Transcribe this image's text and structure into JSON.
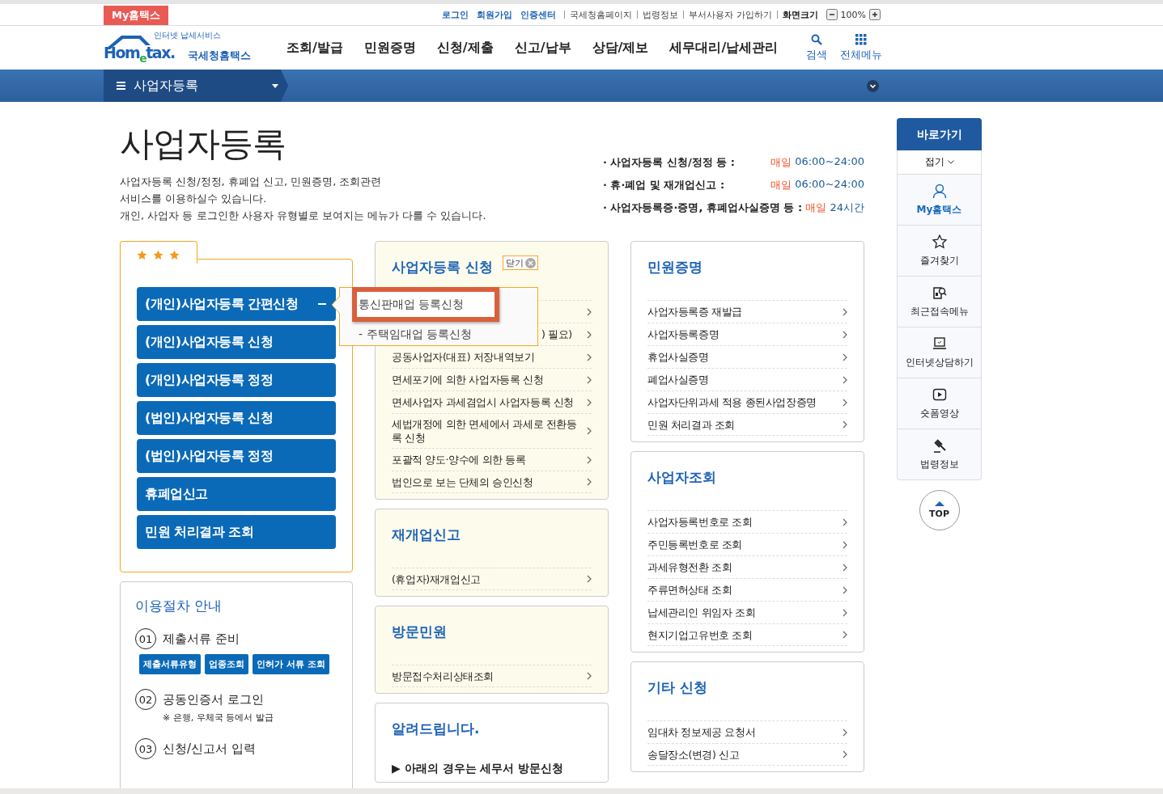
{
  "top_bar": {
    "brand_tab": "My홈택스",
    "links": [
      {
        "label": "로그인",
        "kind": "primary"
      },
      {
        "label": "회원가입",
        "kind": "primary"
      },
      {
        "label": "인증센터",
        "kind": "primary"
      },
      {
        "label": "국세청홈페이지",
        "kind": "plain"
      },
      {
        "label": "법령정보",
        "kind": "plain"
      },
      {
        "label": "부서사용자 가입하기",
        "kind": "plain"
      },
      {
        "label": "화면크기",
        "kind": "strong"
      }
    ],
    "zoom": "100%"
  },
  "header": {
    "logo": {
      "tagline": "인터넷 납세서비스",
      "wordmark": "Hom$_{e}$tax.",
      "name": "국세청홈택스"
    },
    "nav": [
      "조회/발급",
      "민원증명",
      "신청/제출",
      "신고/납부",
      "상담/제보",
      "세무대리/납세관리"
    ],
    "tools": [
      {
        "label": "검색",
        "kind": "search"
      },
      {
        "label": "전체메뉴",
        "kind": "grid"
      }
    ]
  },
  "menu_bar": {
    "current": "사업자등록"
  },
  "page": {
    "title": "사업자등록",
    "description": "사업자등록 신청/정정, 휴폐업 신고, 민원증명, 조회관련\n서비스를 이용하실수 있습니다.\n개인, 사업자 등 로그인한 사용자 유형별로 보여지는 메뉴가 다를 수 있습니다.",
    "hours": [
      {
        "label": "· 사업자등록 신청/정정 등 :",
        "day": "매일",
        "time": "06:00~24:00"
      },
      {
        "label": "· 휴·폐업 및 재개업신고 :",
        "day": "매일",
        "time": "06:00~24:00"
      },
      {
        "label": "· 사업자등록증·증명, 휴폐업사실증명 등 :",
        "day": "매일",
        "time": "24시간"
      }
    ]
  },
  "quick_buttons": [
    {
      "label": "(개인)사업자등록 간편신청",
      "expanded": true
    },
    {
      "label": "(개인)사업자등록 신청",
      "expanded": false
    },
    {
      "label": "(개인)사업자등록 정정",
      "expanded": false
    },
    {
      "label": "(법인)사업자등록 신청",
      "expanded": false
    },
    {
      "label": "(법인)사업자등록 정정",
      "expanded": false
    },
    {
      "label": "휴폐업신고",
      "expanded": false
    },
    {
      "label": "민원 처리결과 조회",
      "expanded": false
    }
  ],
  "popup": {
    "items": [
      {
        "label": "통신판매업 등록신청",
        "selected": true
      },
      {
        "label": "- 주택임대업 등록신청",
        "selected": false
      }
    ]
  },
  "guide": {
    "title": "이용절차 안내",
    "steps": [
      {
        "number": "01",
        "label": "제출서류 준비",
        "buttons": [
          "제출서류유형",
          "업종조회",
          "인허가 서류 조회"
        ]
      },
      {
        "number": "02",
        "label": "공동인증서 로그인",
        "note": "※ 은행, 우체국 등에서 발급"
      },
      {
        "number": "03",
        "label": "신청/신고서 입력"
      }
    ]
  },
  "center_cards": [
    {
      "title": "사업자등록 신청",
      "shaded": true,
      "close_label": "닫기",
      "items": [
        {
          "kind": "covered"
        },
        {
          "kind": "covered",
          "label": ") 필요)"
        },
        {
          "kind": "link",
          "label": "공동사업자(대표) 저장내역보기"
        },
        {
          "kind": "link",
          "label": "면세포기에 의한 사업자등록 신청"
        },
        {
          "kind": "link",
          "label": "면세사업자 과세겸업시 사업자등록 신청"
        },
        {
          "kind": "link",
          "label": "세법개정에 의한 면세에서 과세로 전환등록 신청"
        },
        {
          "kind": "link",
          "label": "포괄적 양도·양수에 의한 등록"
        },
        {
          "kind": "link",
          "label": "법인으로 보는 단체의 승인신청"
        }
      ]
    },
    {
      "title": "재개업신고",
      "shaded": true,
      "items": [
        {
          "kind": "link",
          "label": "(휴업자)재개업신고"
        }
      ]
    },
    {
      "title": "방문민원",
      "shaded": true,
      "items": [
        {
          "kind": "link",
          "label": "방문접수처리상태조회"
        }
      ]
    },
    {
      "title": "알려드립니다.",
      "shaded": false,
      "items": [
        {
          "kind": "notice",
          "label": "▶ 아래의 경우는 세무서 방문신청"
        }
      ]
    }
  ],
  "right_cards": [
    {
      "title": "민원증명",
      "shaded": false,
      "items": [
        {
          "kind": "link",
          "label": "사업자등록증 재발급"
        },
        {
          "kind": "link",
          "label": "사업자등록증명"
        },
        {
          "kind": "link",
          "label": "휴업사실증명"
        },
        {
          "kind": "link",
          "label": "폐업사실증명"
        },
        {
          "kind": "link",
          "label": "사업자단위과세 적용 종된사업장증명"
        },
        {
          "kind": "link",
          "label": "민원 처리결과 조회"
        }
      ]
    },
    {
      "title": "사업자조회",
      "shaded": false,
      "items": [
        {
          "kind": "link",
          "label": "사업자등록번호로 조회"
        },
        {
          "kind": "link",
          "label": "주민등록번호로 조회"
        },
        {
          "kind": "link",
          "label": "과세유형전환 조회"
        },
        {
          "kind": "link",
          "label": "주류면허상태 조회"
        },
        {
          "kind": "link",
          "label": "납세관리인 위임자 조회"
        },
        {
          "kind": "link",
          "label": "현지기업고유번호 조회"
        }
      ]
    },
    {
      "title": "기타 신청",
      "shaded": false,
      "items": [
        {
          "kind": "link",
          "label": "임대차 정보제공 요청서"
        },
        {
          "kind": "link",
          "label": "송달장소(변경) 신고"
        }
      ]
    }
  ],
  "quick_panel": {
    "title": "바로가기",
    "fold": "접기",
    "items": [
      {
        "label": "My홈택스",
        "kind": "user"
      },
      {
        "label": "즐겨찾기",
        "kind": "star"
      },
      {
        "label": "최근접속메뉴",
        "kind": "recent"
      },
      {
        "label": "인터넷상담하기",
        "kind": "laptop"
      },
      {
        "label": "숏폼영상",
        "kind": "video"
      },
      {
        "label": "법령정보",
        "kind": "law"
      }
    ],
    "top": "TOP"
  }
}
